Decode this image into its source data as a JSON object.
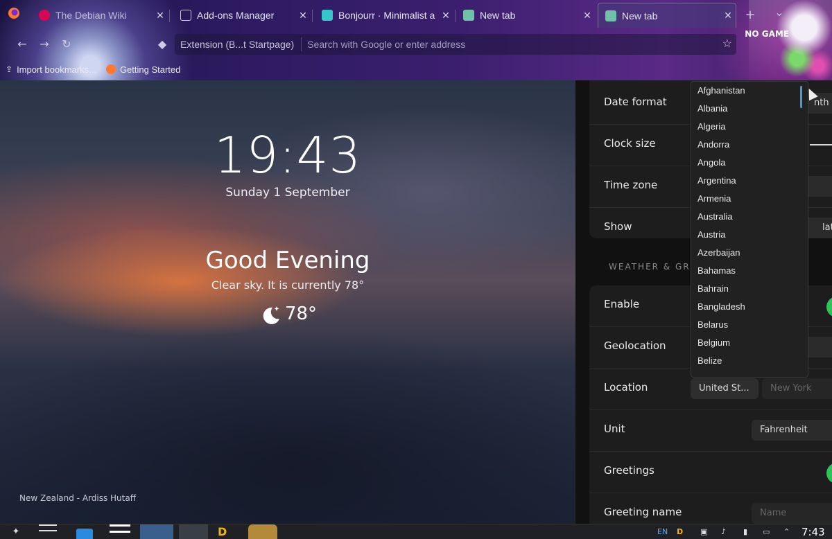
{
  "browser": {
    "tabs": [
      {
        "label": "The Debian Wiki",
        "icon": "debian-icon",
        "color": "#d70751"
      },
      {
        "label": "Add-ons Manager",
        "icon": "puzzle-icon",
        "color": "#9aa0b0"
      },
      {
        "label": "Bonjourr · Minimalist a",
        "icon": "bonjourr-icon",
        "color": "#35c7c7"
      },
      {
        "label": "New tab",
        "icon": "newtab-icon",
        "color": "#6fc1a8"
      },
      {
        "label": "New tab",
        "icon": "newtab-icon",
        "color": "#6fc1a8",
        "active": true
      }
    ],
    "new_tab_symbol": "+",
    "list_tabs_symbol": "⌄",
    "url_identity": "Extension (B...t Startpage)",
    "url_placeholder": "Search with Google or enter address",
    "bookmarks": [
      {
        "label": "Import bookmarks...",
        "icon": "import-icon"
      },
      {
        "label": "Getting Started",
        "icon": "firefox-icon"
      }
    ],
    "theme_badge": "NO GAME"
  },
  "startpage": {
    "time": "19:43",
    "date": "Sunday 1 September",
    "greeting": "Good Evening",
    "description": "Clear sky. It is currently 78°",
    "temperature": "78°",
    "weather_icon": "moon-stars-icon",
    "credit": "New Zealand - Ardiss Hutaff"
  },
  "settings": {
    "time_rows": [
      {
        "label": "Date format",
        "value": "nth"
      },
      {
        "label": "Clock size"
      },
      {
        "label": "Time zone"
      },
      {
        "label": "Show",
        "value": "late"
      }
    ],
    "weather_section_title": "WEATHER & GREET",
    "weather_rows": [
      {
        "label": "Enable",
        "toggle": true
      },
      {
        "label": "Geolocation"
      },
      {
        "label": "Location",
        "country": "United St...",
        "city_placeholder": "New York"
      },
      {
        "label": "Unit",
        "value": "Fahrenheit"
      },
      {
        "label": "Greetings",
        "toggle": true
      },
      {
        "label": "Greeting name",
        "name_placeholder": "Name"
      }
    ],
    "toggle_color": "#2ec25a"
  },
  "country_dropdown": {
    "options": [
      "Afghanistan",
      "Albania",
      "Algeria",
      "Andorra",
      "Angola",
      "Argentina",
      "Armenia",
      "Australia",
      "Austria",
      "Azerbaijan",
      "Bahamas",
      "Bahrain",
      "Bangladesh",
      "Belarus",
      "Belgium",
      "Belize"
    ]
  },
  "taskbar": {
    "language": "EN",
    "clock": "7:43"
  }
}
